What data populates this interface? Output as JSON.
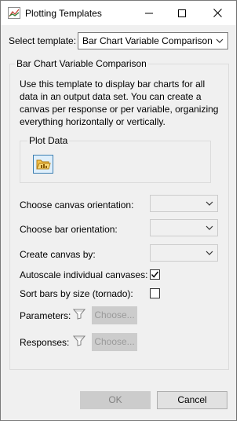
{
  "window": {
    "title": "Plotting Templates"
  },
  "template": {
    "label": "Select template:",
    "selected": "Bar Chart Variable Comparison"
  },
  "group": {
    "title": "Bar Chart Variable Comparison",
    "description": "Use this template to display bar charts for all data in an output data set.  You can create a canvas per response or per variable, organizing everything horizontally or vertically."
  },
  "plot_data": {
    "title": "Plot Data"
  },
  "options": {
    "canvas_orientation": "Choose canvas orientation:",
    "bar_orientation": "Choose bar orientation:",
    "canvas_by": "Create canvas by:",
    "autoscale": "Autoscale individual canvases:",
    "autoscale_checked": true,
    "sort_bars": "Sort bars by size (tornado):",
    "sort_bars_checked": false,
    "parameters": "Parameters:",
    "responses": "Responses:",
    "choose": "Choose..."
  },
  "footer": {
    "ok": "OK",
    "cancel": "Cancel"
  },
  "icons": {
    "app": "chart-icon",
    "minimize": "minimize-icon",
    "maximize": "maximize-icon",
    "close": "close-icon",
    "chevron": "chevron-down-icon",
    "funnel": "filter-icon",
    "plot": "folder-chart-icon"
  }
}
